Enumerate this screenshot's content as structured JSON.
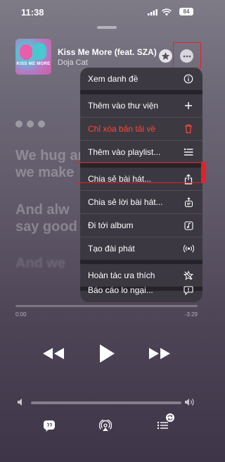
{
  "status_bar": {
    "time": "11:38",
    "battery": "84"
  },
  "now_playing": {
    "title": "Kiss Me More (feat. SZA)",
    "artist": "Doja Cat",
    "art_text": "KISS ME MORE"
  },
  "lyrics": {
    "lines": [
      "We hug and",
      "we make",
      "And alw",
      "say good",
      "And we"
    ]
  },
  "menu": {
    "items": [
      {
        "label": "Xem danh đề",
        "icon": "info-icon"
      },
      {
        "label": "Thêm vào thư viện",
        "icon": "plus-icon"
      },
      {
        "label": "Chỉ xóa bản tải về",
        "icon": "trash-icon",
        "color": "#ff453a"
      },
      {
        "label": "Thêm vào playlist...",
        "icon": "playlist-add-icon"
      },
      {
        "label": "Chia sẻ bài hát...",
        "icon": "share-icon"
      },
      {
        "label": "Chia sẻ lời bài hát...",
        "icon": "share-lyrics-icon"
      },
      {
        "label": "Đi tới album",
        "icon": "album-icon"
      },
      {
        "label": "Tạo đài phát",
        "icon": "radio-icon"
      },
      {
        "label": "Hoàn tác ưa thích",
        "icon": "unfavorite-star-icon"
      },
      {
        "label": "Báo cáo lo ngại...",
        "icon": "report-icon"
      }
    ]
  },
  "progress": {
    "elapsed": "0:00",
    "remaining": "-3:29",
    "fraction": 0.0
  },
  "volume": {
    "level": 0.0
  },
  "colors": {
    "highlight": "#e5202a",
    "destructive": "#ff453a"
  }
}
